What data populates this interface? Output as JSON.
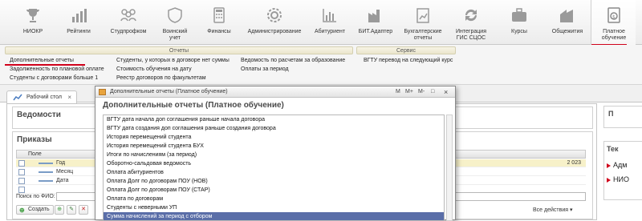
{
  "toolbar": {
    "items": [
      {
        "label": "",
        "icon": "partial-icon"
      },
      {
        "label": "НИОКР",
        "icon": "trophy-icon"
      },
      {
        "label": "Рейтинги",
        "icon": "bar-chart-icon"
      },
      {
        "label": "Студпрофком",
        "icon": "people-icon"
      },
      {
        "label": "Воинский учет",
        "icon": "shield-icon"
      },
      {
        "label": "Финансы",
        "icon": "calculator-icon"
      },
      {
        "label": "Администрирование",
        "icon": "gear-icon"
      },
      {
        "label": "Абитуриент",
        "icon": "chart-icon"
      },
      {
        "label": "БИТ.Адаптер",
        "icon": "factory-icon"
      },
      {
        "label": "Бухгалтерские отчеты",
        "icon": "report-icon"
      },
      {
        "label": "Интеграция ГИС СЦОС",
        "icon": "sync-icon"
      },
      {
        "label": "Курсы",
        "icon": "briefcase-icon"
      },
      {
        "label": "Общежития",
        "icon": "building-icon"
      },
      {
        "label": "Платное обучение",
        "icon": "payment-icon"
      }
    ]
  },
  "submenu": {
    "reports_group": "Отчеты",
    "service_group": "Сервис",
    "col1": [
      "Дополнительные отчеты",
      "Задолженность по плановой оплате",
      "Студенты с договорами больше 1"
    ],
    "col2": [
      "Студенты, у которых в договоре нет суммы",
      "Стоимость обучения на дату",
      "Реестр договоров по факультетам"
    ],
    "col3": [
      "Ведомость по расчетам за образование",
      "Оплаты за период"
    ],
    "service": [
      "ВГТУ перевод на следующий курс"
    ]
  },
  "tab": {
    "label": "Рабочий стол",
    "close": "×"
  },
  "workspace": {
    "vedomosti_title": "Ведомости",
    "prikazy_title": "Приказы",
    "grid_header": "Поле",
    "rows": [
      {
        "name": "Год",
        "value": "2 023",
        "selected": true
      },
      {
        "name": "Месяц",
        "value": ""
      },
      {
        "name": "Дата",
        "value": ""
      },
      {
        "name": "",
        "value": ""
      }
    ],
    "search_label": "Поиск по ФИО:",
    "create_label": "Создать",
    "all_actions": "Все действия ▾"
  },
  "right_panel": {
    "top_title": "П",
    "tech_title": "Тек",
    "items": [
      "Адм",
      "НИО"
    ]
  },
  "modal": {
    "window_title": "Дополнительные отчеты (Платное обучение)",
    "controls": [
      "M",
      "M+",
      "M-",
      "□",
      "×"
    ],
    "heading": "Дополнительные отчеты (Платное обучение)",
    "items": [
      "ВГТУ дата начала доп соглашения раньше начала договора",
      "ВГТУ дата создания доп соглашения раньше создания договора",
      "История перемещений студента",
      "История перемещений студента БУХ",
      "Итоги по начислениям (за период)",
      "Оборотно-сальдовая ведомость",
      "Оплата абитуриентов",
      "Оплата Долг по договорам ПОУ (НОВ)",
      "Оплата Долг по договорам ПОУ (СТАР)",
      "Оплата по договорам",
      "Студенты с неверными УП",
      "Сумма начислений за период с отбором"
    ],
    "selected_index": 11
  }
}
